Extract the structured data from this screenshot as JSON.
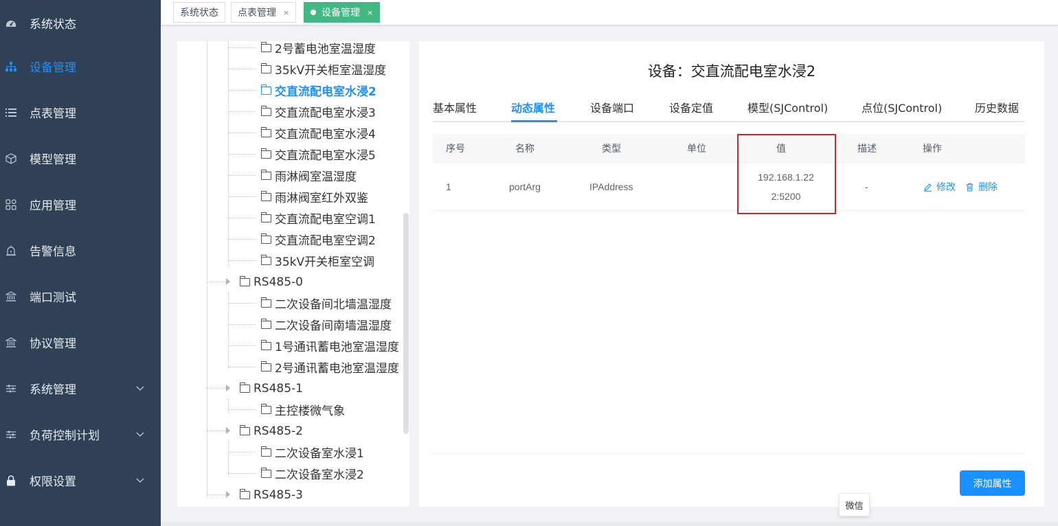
{
  "sidebar": {
    "items": [
      {
        "label": "系统状态",
        "icon": "dashboard-icon",
        "active": false
      },
      {
        "label": "设备管理",
        "icon": "sitemap-icon",
        "active": true
      },
      {
        "label": "点表管理",
        "icon": "list-icon",
        "active": false
      },
      {
        "label": "模型管理",
        "icon": "cube-icon",
        "active": false
      },
      {
        "label": "应用管理",
        "icon": "apps-icon",
        "active": false
      },
      {
        "label": "告警信息",
        "icon": "alarm-icon",
        "active": false
      },
      {
        "label": "端口测试",
        "icon": "bank-icon",
        "active": false
      },
      {
        "label": "协议管理",
        "icon": "bank-icon",
        "active": false
      },
      {
        "label": "系统管理",
        "icon": "sliders-icon",
        "active": false,
        "expandable": true
      },
      {
        "label": "负荷控制计划",
        "icon": "sliders-icon",
        "active": false,
        "expandable": true
      },
      {
        "label": "权限设置",
        "icon": "lock-icon",
        "active": false,
        "expandable": true
      }
    ]
  },
  "tags": {
    "items": [
      {
        "label": "系统状态",
        "closable": false,
        "active": false
      },
      {
        "label": "点表管理",
        "closable": true,
        "active": false
      },
      {
        "label": "设备管理",
        "closable": true,
        "active": true
      }
    ],
    "close_glyph": "×"
  },
  "tree": {
    "nodes": [
      {
        "label": "2号蓄电池室温湿度",
        "level": 2
      },
      {
        "label": "35kV开关柜室温湿度",
        "level": 2
      },
      {
        "label": "交直流配电室水浸2",
        "level": 2,
        "selected": true
      },
      {
        "label": "交直流配电室水浸3",
        "level": 2
      },
      {
        "label": "交直流配电室水浸4",
        "level": 2
      },
      {
        "label": "交直流配电室水浸5",
        "level": 2
      },
      {
        "label": "雨淋阀室温湿度",
        "level": 2
      },
      {
        "label": "雨淋阀室红外双鉴",
        "level": 2
      },
      {
        "label": "交直流配电室空调1",
        "level": 2
      },
      {
        "label": "交直流配电室空调2",
        "level": 2
      },
      {
        "label": "35kV开关柜室空调",
        "level": 2
      },
      {
        "label": "RS485-0",
        "level": 1
      },
      {
        "label": "二次设备间北墙温湿度",
        "level": 2
      },
      {
        "label": "二次设备间南墙温湿度",
        "level": 2
      },
      {
        "label": "1号通讯蓄电池室温湿度",
        "level": 2
      },
      {
        "label": "2号通讯蓄电池室温湿度",
        "level": 2
      },
      {
        "label": "RS485-1",
        "level": 1
      },
      {
        "label": "主控楼微气象",
        "level": 2
      },
      {
        "label": "RS485-2",
        "level": 1
      },
      {
        "label": "二次设备室水浸1",
        "level": 2
      },
      {
        "label": "二次设备室水浸2",
        "level": 2
      },
      {
        "label": "RS485-3",
        "level": 1
      }
    ]
  },
  "detail": {
    "title": "设备：交直流配电室水浸2",
    "tabs": [
      "基本属性",
      "动态属性",
      "设备端口",
      "设备定值",
      "模型(SJControl)",
      "点位(SJControl)",
      "历史数据"
    ],
    "active_tab": 1,
    "table": {
      "columns": [
        "序号",
        "名称",
        "类型",
        "单位",
        "值",
        "描述",
        "操作"
      ],
      "rows": [
        {
          "index": "1",
          "name": "portArg",
          "type": "IPAddress",
          "unit": "",
          "value": "192.168.1.22\n2:5200",
          "desc": "-"
        }
      ],
      "actions": {
        "edit": "修改",
        "delete": "删除"
      }
    },
    "add_button": "添加属性"
  },
  "tooltip": "微信",
  "colors": {
    "sidebar_bg": "#304156",
    "accent": "#1e90ff",
    "active_tag": "#42b983",
    "highlight": "#e02020",
    "primary_button": "#1890ff"
  }
}
